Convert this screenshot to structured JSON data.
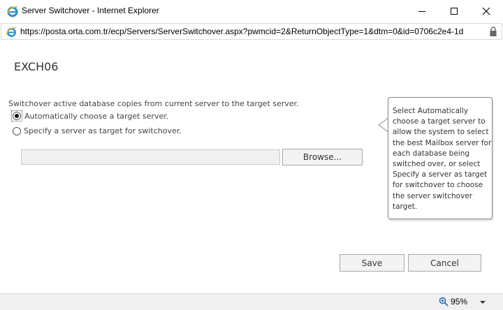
{
  "window": {
    "title": "Server Switchover - Internet Explorer",
    "icon": "internet-explorer-icon"
  },
  "address_bar": {
    "url": "https://posta.orta.com.tr/ecp/Servers/ServerSwitchover.aspx?pwmcid=2&ReturnObjectType=1&dtm=0&id=0706c2e4-1d",
    "secure_icon": "lock-icon"
  },
  "page": {
    "server_name": "EXCH06",
    "instructions": "Switchover active database copies from current server to the target server.",
    "options": [
      {
        "label": "Automatically choose a target server.",
        "checked": true
      },
      {
        "label": "Specify a server as target for switchover.",
        "checked": false
      }
    ],
    "server_field_value": "",
    "browse_label": "Browse...",
    "help_text": "Select Automatically choose a target server to allow the system to select the best Mailbox server for each database being switched over, or select Specify a server as target for switchover to choose the server switchover target.",
    "save_label": "Save",
    "cancel_label": "Cancel"
  },
  "status_bar": {
    "zoom": "95%"
  }
}
